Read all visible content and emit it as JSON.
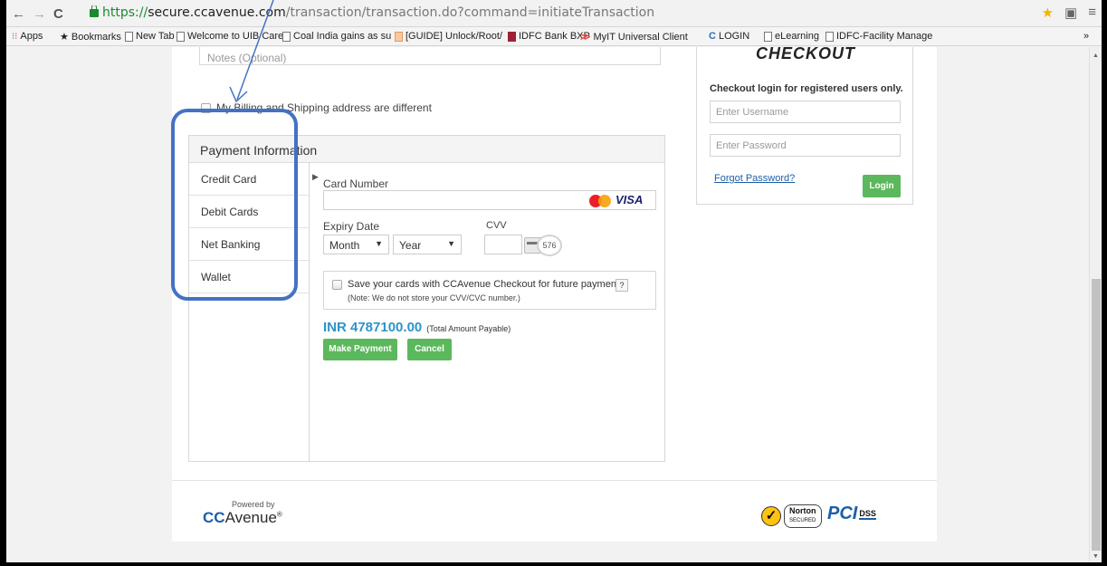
{
  "browser": {
    "url_https": "https://",
    "url_host": "secure.ccavenue.com",
    "url_path": "/transaction/transaction.do?command=initiateTransaction",
    "bookmarks": [
      {
        "label": "Apps"
      },
      {
        "label": "Bookmarks"
      },
      {
        "label": "New Tab"
      },
      {
        "label": "Welcome to UIB Care"
      },
      {
        "label": "Coal India gains as su"
      },
      {
        "label": "[GUIDE] Unlock/Root/"
      },
      {
        "label": "IDFC Bank BXP"
      },
      {
        "label": "MyIT Universal Client"
      },
      {
        "label": "LOGIN"
      },
      {
        "label": "eLearning"
      },
      {
        "label": "IDFC-Facility Manage"
      }
    ],
    "overflow": "»"
  },
  "form": {
    "notes_placeholder": "Notes (Optional)",
    "billing_label": "My Billing and Shipping address are different"
  },
  "payment": {
    "header": "Payment Information",
    "tabs": [
      {
        "label": "Credit Card"
      },
      {
        "label": "Debit Cards"
      },
      {
        "label": "Net Banking"
      },
      {
        "label": "Wallet"
      }
    ],
    "card_number_label": "Card Number",
    "visa": "VISA",
    "expiry_label": "Expiry Date",
    "month": "Month",
    "year": "Year",
    "cvv_label": "CVV",
    "cvv_sample": "576",
    "save_text": "Save your cards with CCAvenue Checkout for future payments",
    "help": "?",
    "save_note": "(Note: We do not store your CVV/CVC number.)",
    "amount": "INR 4787100.00",
    "amount_note": "(Total Amount Payable)",
    "make_payment": "Make Payment",
    "cancel": "Cancel"
  },
  "checkout": {
    "logo": "CHECKOUT",
    "title": "Checkout login for registered users only.",
    "username_placeholder": "Enter Username",
    "password_placeholder": "Enter Password",
    "forgot": "Forgot Password?",
    "login": "Login"
  },
  "footer": {
    "powered_by": "Powered by",
    "brand_cc": "CC",
    "brand_avenue": "Avenue",
    "brand_mark": "®",
    "norton": "Norton",
    "norton_secured": "SECURED",
    "pci": "PCI",
    "dss": "DSS"
  },
  "colors": {
    "accent_green": "#5cb85c",
    "amount_blue": "#2e93c9",
    "annotation_blue": "#4472c4"
  }
}
